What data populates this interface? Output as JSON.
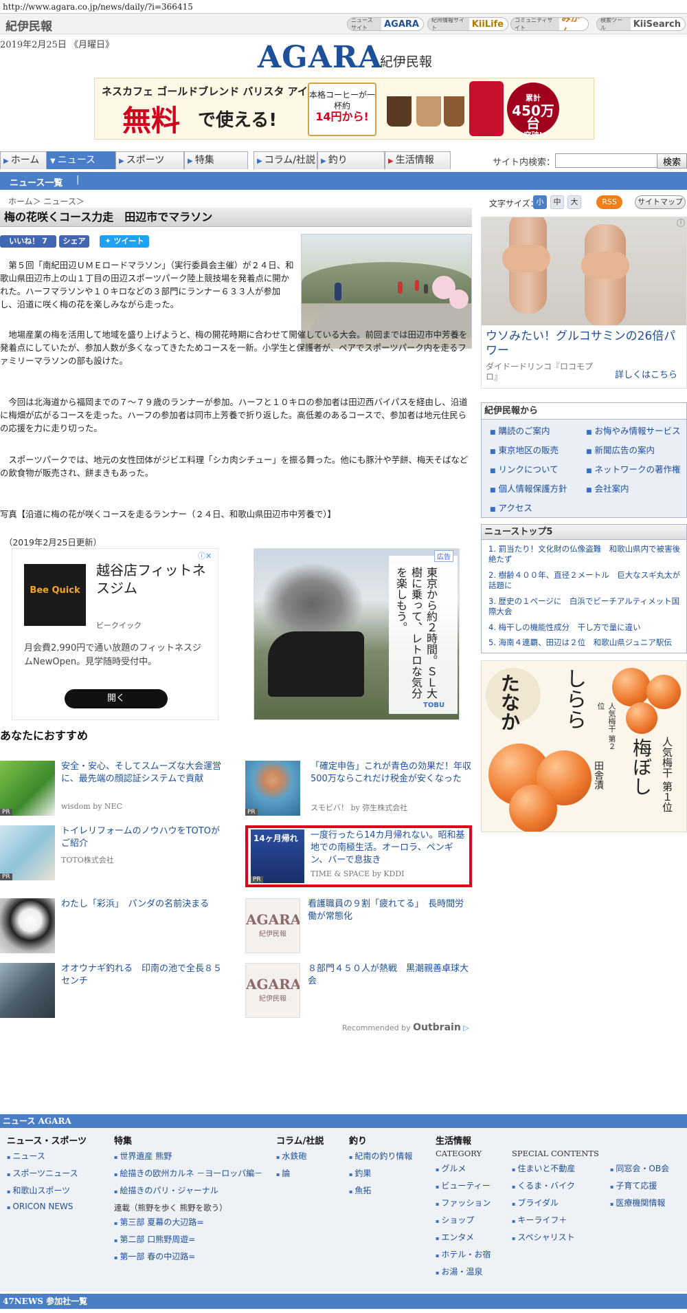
{
  "browser": {
    "url": "http://www.agara.co.jp/news/daily/?i=366415"
  },
  "top": {
    "brand": "紀伊民報",
    "sites": [
      {
        "pre": "ニュースサイト",
        "name": "AGARA"
      },
      {
        "pre": "紀州情報サイト",
        "name": "KiiLife"
      },
      {
        "pre": "コミュニティサイト",
        "name": "みかん"
      },
      {
        "pre": "検索ツール",
        "name": "KiiSearch"
      }
    ]
  },
  "header": {
    "date": "2019年2月25日 《月曜日》",
    "logo": "AGARA",
    "logo_sub": "紀伊民報"
  },
  "banner": {
    "line1": "ネスカフェ ゴールドブレンド バリスタ アイが",
    "free": "無料",
    "use": "で使える!",
    "cup_text": "本格コーヒーが一杯約",
    "cup_price": "14円から!",
    "badge_top": "累計",
    "badge_big": "450万台",
    "badge_bottom": "突破!"
  },
  "nav": {
    "tabs": [
      "ホーム",
      "ニュース",
      "スポーツ",
      "特集",
      "コラム/社説",
      "釣り",
      "生活情報"
    ],
    "search_label": "サイト内検索：",
    "search_value": "",
    "search_button": "検索"
  },
  "subnav": {
    "item": "ニュース一覧",
    "sep": "|"
  },
  "breadcrumb": "ホーム＞ ニュース＞",
  "article": {
    "title": "梅の花咲くコース力走　田辺市でマラソン",
    "like": "いいね！ 7",
    "share": "シェア",
    "tweet": "ツイート",
    "paragraphs": [
      "第５回「南紀田辺ＵＭＥロードマラソン」（実行委員会主催）が２４日、和歌山県田辺市上の山１丁目の田辺スポーツパーク陸上競技場を発着点に開かれた。ハーフマラソンや１０キロなどの３部門にランナー６３３人が参加し、沿道に咲く梅の花を楽しみながら走った。",
      "地場産業の梅を活用して地域を盛り上げようと、梅の開花時期に合わせて開催している大会。前回までは田辺市中芳養を発着点にしていたが、参加人数が多くなってきたためコースを一新。小学生と保護者が、ペアでスポーツパーク内を走るファミリーマラソンの部も設けた。",
      "今回は北海道から福岡までの７～７９歳のランナーが参加。ハーフと１０キロの参加者は田辺西バイパスを経由し、沿道に梅畑が広がるコースを走った。ハーフの参加者は同市上芳養で折り返した。高低差のあるコースで、参加者は地元住民らの応援を力に走り切った。",
      "スポーツパークでは、地元の女性団体がジビエ料理「シカ肉シチュー」を振る舞った。他にも豚汁や芋餅、梅天そばなどの飲食物が販売され、餅まきもあった。"
    ],
    "caption": "写真【沿道に梅の花が咲くコースを走るランナー（２４日、和歌山県田辺市中芳養で）】",
    "updated": "（2019年2月25日更新）"
  },
  "ad_fitness": {
    "logo": "Bee Quick",
    "title": "越谷店フィットネスジム",
    "advertiser": "ビークイック",
    "desc": "月会費2,990円で通い放題のフィットネスジムNewOpen。見学随時受付中。",
    "cta": "開く"
  },
  "ad_train": {
    "tag": "広告",
    "text": "東京から約２時間。ＳＬ大樹に乗って、レトロな気分を楽しもう。",
    "brand": "TOBU"
  },
  "recommend": {
    "heading": "あなたにおすすめ",
    "pr": "PR",
    "items": [
      {
        "title": "安全・安心、そしてスムーズな大会運営に、最先端の顔認証システムで貢献",
        "source": "wisdom by NEC"
      },
      {
        "title": "「確定申告」これが青色の効果だ！年収500万ならこれだけ税金が安くなった",
        "source": "スモビバ！ by 弥生株式会社"
      },
      {
        "title": "トイレリフォームのノウハウをTOTOがご紹介",
        "source": "TOTO株式会社"
      },
      {
        "title": "一度行ったら14カ月帰れない。昭和基地での南極生活。オーロラ、ペンギン、バーで息抜き",
        "source": "TIME & SPACE by KDDI",
        "thumb_label": "14ヶ月帰れ"
      },
      {
        "title": "わたし「彩浜」　パンダの名前決まる",
        "source": ""
      },
      {
        "title": "看護職員の９割「疲れてる」　長時間労働が常態化",
        "source": ""
      },
      {
        "title": "オオウナギ釣れる　印南の池で全長８５センチ",
        "source": ""
      },
      {
        "title": "８部門４５０人が熱戦　黒潮親善卓球大会",
        "source": ""
      }
    ],
    "agara_thumb": {
      "logo": "AGARA",
      "sub": "紀伊民報"
    },
    "outbrain_pre": "Recommended by",
    "outbrain": "Outbrain"
  },
  "side": {
    "fontsize_label": "文字サイズ：",
    "fontsizes": [
      "小",
      "中",
      "大"
    ],
    "rss": "RSS",
    "sitemap": "サイトマップ",
    "ad_knee": {
      "title": "ウソみたい！グルコサミンの26倍パワー",
      "advertiser": "ダイドードリンコ『ロコモプロ』",
      "more": "詳しくはこちら",
      "info": "i"
    },
    "kii": {
      "heading": "紀伊民報から",
      "links": [
        "購読のご案内",
        "お悔やみ情報サービス",
        "東京地区の販売",
        "新聞広告の案内",
        "リンクについて",
        "ネットワークの著作権",
        "個人情報保護方針",
        "会社案内",
        "アクセス"
      ]
    },
    "top5": {
      "heading": "ニューストップ5",
      "items": [
        "罰当たり！文化財の仏像盗難　和歌山県内で被害後絶たず",
        "樹齢４００年、直径２メートル　巨大なスギ丸太が話題に",
        "歴史の１ページに　白浜でビーチアルティメット国際大会",
        "梅干しの機能性成分　干し方で量に違い",
        "海南４連覇、田辺は２位　和歌山県ジュニア駅伝"
      ]
    },
    "ad_ume": {
      "brand": "たなか",
      "shira": "しらら",
      "v1": "梅ぼし",
      "v2": "人気梅干 第１位",
      "v2b": "人気梅干 第２位",
      "v3": "田舎漬"
    }
  },
  "footer": {
    "bar": "ニュース AGARA",
    "cols": {
      "news": {
        "h": "ニュース・スポーツ",
        "links": [
          "ニュース",
          "スポーツニュース",
          "和歌山スポーツ",
          "ORICON NEWS"
        ]
      },
      "tokushu": {
        "h": "特集",
        "links": [
          "世界遺産 熊野",
          "絵描きの欧州カルネ －ヨーロッパ編－",
          "絵描きのパリ・ジャーナル"
        ],
        "sub": "連載（熊野を歩く 熊野を歌う）",
        "sub_links": [
          "第三部 夏幕の大辺路=",
          "第二部 口熊野周遊=",
          "第一部 春の中辺路="
        ]
      },
      "column": {
        "h": "コラム/社説",
        "links": [
          "水鉄砲",
          "論"
        ]
      },
      "fishing": {
        "h": "釣り",
        "links": [
          "紀南の釣り情報",
          "釣果",
          "魚拓"
        ]
      },
      "life": {
        "h": "生活情報",
        "cat": "CATEGORY",
        "cat_links": [
          "グルメ",
          "ビューティー",
          "ファッション",
          "ショップ",
          "エンタメ",
          "ホテル・お宿",
          "お湯・温泉"
        ],
        "sp": "SPECIAL CONTENTS",
        "sp_links": [
          "住まいと不動産",
          "くるま・バイク",
          "ブライダル",
          "キーライフ＋",
          "スペシャリスト"
        ],
        "sp2_links": [
          "同窓会・OB会",
          "子育て応援",
          "医療機関情報"
        ]
      }
    },
    "bar2": "47NEWS 参加社一覧"
  }
}
